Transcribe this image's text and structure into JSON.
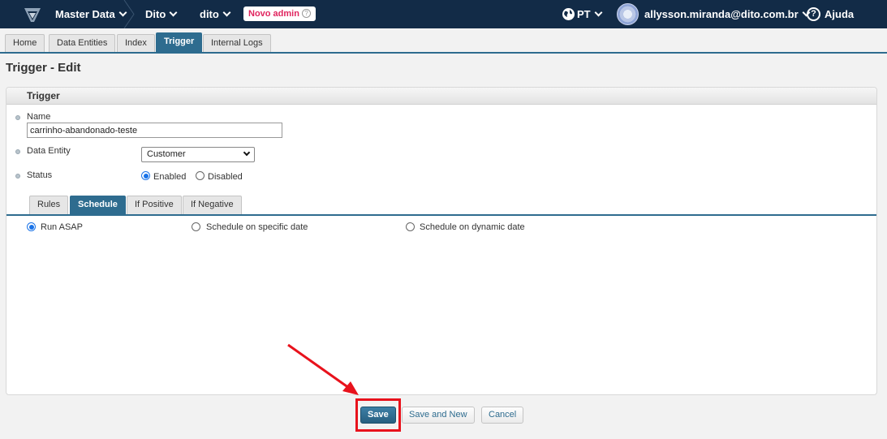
{
  "topbar": {
    "app_name": "Master Data",
    "account": "Dito",
    "store": "dito",
    "badge": "Novo admin",
    "language": "PT",
    "user_email": "allysson.miranda@dito.com.br",
    "help_label": "Ajuda",
    "background_color": "#122b47"
  },
  "tabs": [
    {
      "label": "Home"
    },
    {
      "label": "Data Entities"
    },
    {
      "label": "Index"
    },
    {
      "label": "Trigger",
      "active": true
    },
    {
      "label": "Internal Logs"
    }
  ],
  "page_title": "Trigger - Edit",
  "panel": {
    "title": "Trigger",
    "name_label": "Name",
    "name_value": "carrinho-abandonado-teste",
    "data_entity_label": "Data Entity",
    "data_entity_value": "Customer",
    "status_label": "Status",
    "status_options": [
      {
        "label": "Enabled",
        "checked": true
      },
      {
        "label": "Disabled",
        "checked": false
      }
    ],
    "subtabs": [
      {
        "label": "Rules"
      },
      {
        "label": "Schedule",
        "active": true
      },
      {
        "label": "If Positive"
      },
      {
        "label": "If Negative"
      }
    ],
    "schedule_options": [
      {
        "label": "Run ASAP",
        "checked": true
      },
      {
        "label": "Schedule on specific date",
        "checked": false
      },
      {
        "label": "Schedule on dynamic date",
        "checked": false
      }
    ]
  },
  "buttons": {
    "save": "Save",
    "save_and_new": "Save and New",
    "cancel": "Cancel"
  },
  "colors": {
    "accent": "#2e6c8f",
    "annotation": "#e8121c"
  }
}
